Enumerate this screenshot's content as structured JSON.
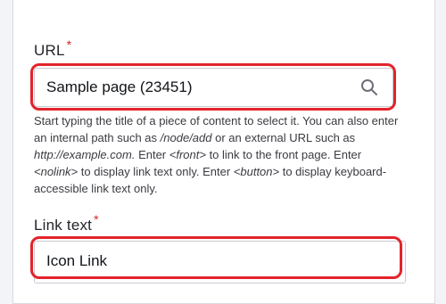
{
  "url_field": {
    "label": "URL",
    "required_marker": "*",
    "value": "Sample page (23451)",
    "icon": "search-icon",
    "description": {
      "p1": "Start typing the title of a piece of content to select it. You can also enter an internal path such as ",
      "code_node_add": "/node/add",
      "p2": " or an external URL such as ",
      "code_example": "http://example.com.",
      "p3": " Enter ",
      "code_front": "<front>",
      "p4": " to link to the front page. Enter ",
      "code_nolink": "<nolink>",
      "p5": " to display link text only. Enter ",
      "code_button": "<button>",
      "p6": " to display keyboard-accessible link text only."
    }
  },
  "link_text_field": {
    "label": "Link text",
    "required_marker": "*",
    "value": "Icon Link"
  },
  "colors": {
    "highlight": "#e3242b",
    "required": "#d72222"
  }
}
